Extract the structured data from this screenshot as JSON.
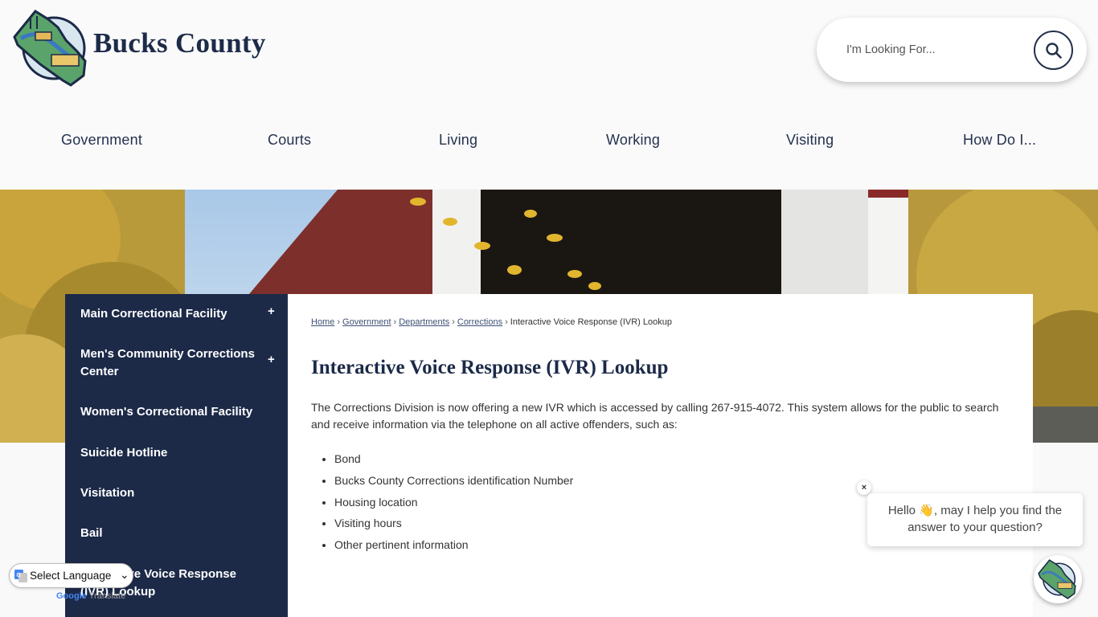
{
  "site": {
    "name": "Bucks County"
  },
  "search": {
    "placeholder": "I'm Looking For..."
  },
  "nav": {
    "items": [
      {
        "label": "Government"
      },
      {
        "label": "Courts"
      },
      {
        "label": "Living"
      },
      {
        "label": "Working"
      },
      {
        "label": "Visiting"
      },
      {
        "label": "How Do I..."
      }
    ]
  },
  "sidebar": {
    "items": [
      {
        "label": "Main Correctional Facility",
        "expand": "+"
      },
      {
        "label": "Men's Community Corrections Center",
        "expand": "+"
      },
      {
        "label": "Women's Correctional Facility"
      },
      {
        "label": "Suicide Hotline"
      },
      {
        "label": "Visitation"
      },
      {
        "label": "Bail"
      },
      {
        "label": "Interactive Voice Response (IVR) Lookup"
      }
    ]
  },
  "breadcrumb": {
    "items": [
      {
        "label": "Home"
      },
      {
        "label": "Government"
      },
      {
        "label": "Departments"
      },
      {
        "label": "Corrections"
      }
    ],
    "current": "Interactive Voice Response (IVR) Lookup",
    "separator": "›"
  },
  "page": {
    "title": "Interactive Voice Response (IVR) Lookup",
    "intro": "The Corrections Division is now offering a new IVR which is accessed by calling 267-915-4072. This system allows for the public to search and receive information via the telephone on all active offenders, such as:",
    "bullets": [
      "Bond",
      "Bucks County Corrections identification Number",
      "Housing location",
      "Visiting hours",
      "Other pertinent information"
    ]
  },
  "translate": {
    "label": "Select Language",
    "powered_by_google": "Google",
    "powered_by_translate": "Translate"
  },
  "chat": {
    "greeting_before": "Hello ",
    "wave_emoji": "👋",
    "greeting_after": ", may I help you find the answer to your question?",
    "close": "×"
  },
  "colors": {
    "navy": "#1c2a48",
    "header_bg": "#fafafb"
  }
}
